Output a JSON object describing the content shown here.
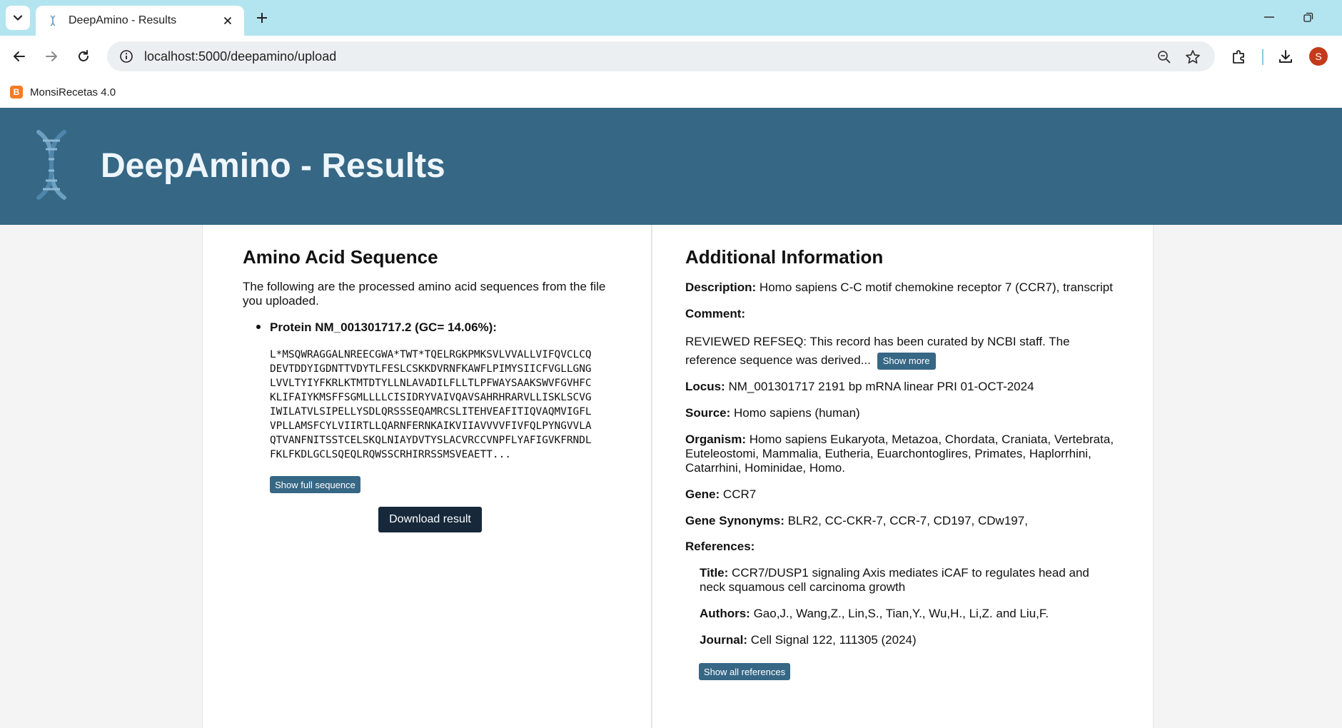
{
  "browser": {
    "tab_title": "DeepAmino - Results",
    "url": "localhost:5000/deepamino/upload",
    "bookmark_label": "MonsiRecetas 4.0",
    "avatar_letter": "S"
  },
  "page": {
    "header_title": "DeepAmino - Results",
    "left": {
      "heading": "Amino Acid Sequence",
      "intro": "The following are the processed amino acid sequences from the file you uploaded.",
      "protein_label": "Protein NM_001301717.2 (GC= 14.06%):",
      "sequence_lines": [
        "L*MSQWRAGGALNREECGWA*TWT*TQELRGKPMKSVLVVALLVIFQVCLCQ",
        "DEVTDDYIGDNTTVDYTLFESLCSKKDVRNFKAWFLPIMYSIICFVGLLGNG",
        "LVVLTYIYFKRLKTMTDTYLLNLAVADILFLLTLPFWAYSAAKSWVFGVHFC",
        "KLIFAIYKMSFFSGMLLLLCISIDRYVAIVQAVSAHRHRARVLLISKLSCVG",
        "IWILATVLSIPELLYSDLQRSSSEQAMRCSLITEHVEAFITIQVAQMVIGFL",
        "VPLLAMSFCYLVIIRTLLQARNFERNKAIKVIIAVVVVFIVFQLPYNGVVLA",
        "QTVANFNITSSTCELSKQLNIAYDVTYSLACVRCCVNPFLYAFIGVKFRNDL",
        "FKLFKDLGCLSQEQLRQWSSCRHIRRSSMSVEAETT..."
      ],
      "show_full_sequence": "Show full sequence",
      "download_result": "Download result"
    },
    "right": {
      "heading": "Additional Information",
      "description_label": "Description:",
      "description": "Homo sapiens C-C motif chemokine receptor 7 (CCR7), transcript",
      "comment_label": "Comment:",
      "comment": "REVIEWED REFSEQ: This record has been curated by NCBI staff. The reference sequence was derived...",
      "show_more": "Show more",
      "locus_label": "Locus:",
      "locus": "NM_001301717 2191 bp mRNA linear PRI 01-OCT-2024",
      "source_label": "Source:",
      "source": "Homo sapiens (human)",
      "organism_label": "Organism:",
      "organism": "Homo sapiens Eukaryota, Metazoa, Chordata, Craniata, Vertebrata, Euteleostomi, Mammalia, Eutheria, Euarchontoglires, Primates, Haplorrhini, Catarrhini, Hominidae, Homo.",
      "gene_label": "Gene:",
      "gene": "CCR7",
      "synonyms_label": "Gene Synonyms:",
      "synonyms": "BLR2, CC-CKR-7, CCR-7, CD197, CDw197,",
      "references_label": "References:",
      "ref_title_label": "Title:",
      "ref_title": "CCR7/DUSP1 signaling Axis mediates iCAF to regulates head and neck squamous cell carcinoma growth",
      "ref_authors_label": "Authors:",
      "ref_authors": "Gao,J., Wang,Z., Lin,S., Tian,Y., Wu,H., Li,Z. and Liu,F.",
      "ref_journal_label": "Journal:",
      "ref_journal": "Cell Signal 122, 111305 (2024)",
      "show_all_references": "Show all references"
    }
  }
}
